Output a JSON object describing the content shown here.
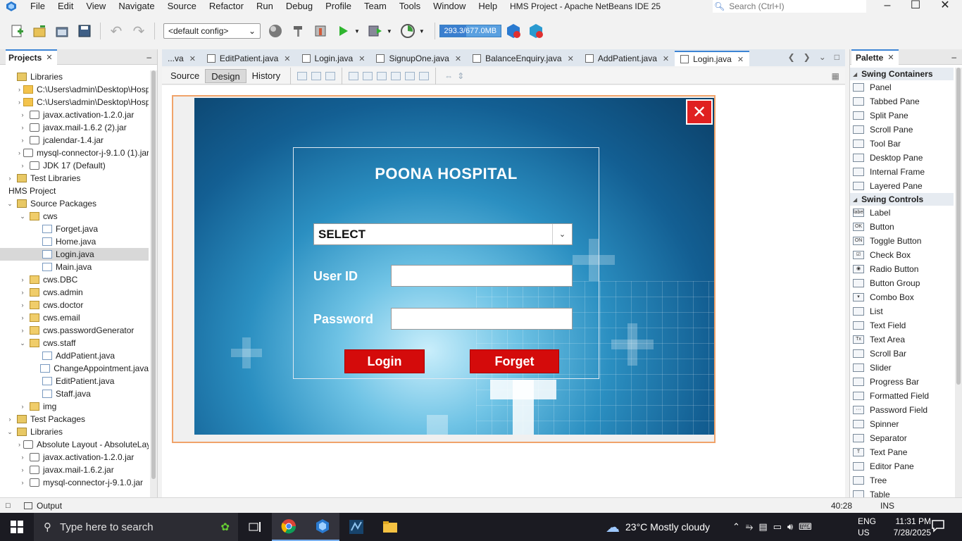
{
  "window": {
    "title": "HMS Project - Apache NetBeans IDE 25"
  },
  "menu": [
    "File",
    "Edit",
    "View",
    "Navigate",
    "Source",
    "Refactor",
    "Run",
    "Debug",
    "Profile",
    "Team",
    "Tools",
    "Window",
    "Help"
  ],
  "search": {
    "placeholder": "Search (Ctrl+I)"
  },
  "toolbar": {
    "config": "<default config>",
    "memory": "293.3/677.0MB",
    "memory_fraction": 0.43
  },
  "projects": {
    "title": "Projects",
    "tree": [
      {
        "label": "Libraries",
        "level": 0,
        "toggle": "",
        "icon": "lib"
      },
      {
        "label": "C:\\Users\\admin\\Desktop\\Hosp",
        "level": 1,
        "toggle": "›",
        "icon": "folder"
      },
      {
        "label": "C:\\Users\\admin\\Desktop\\Hosp",
        "level": 1,
        "toggle": "›",
        "icon": "folder"
      },
      {
        "label": "javax.activation-1.2.0.jar",
        "level": 1,
        "toggle": "›",
        "icon": "jar"
      },
      {
        "label": "javax.mail-1.6.2 (2).jar",
        "level": 1,
        "toggle": "›",
        "icon": "jar"
      },
      {
        "label": "jcalendar-1.4.jar",
        "level": 1,
        "toggle": "›",
        "icon": "jar"
      },
      {
        "label": "mysql-connector-j-9.1.0 (1).jar",
        "level": 1,
        "toggle": "›",
        "icon": "jar"
      },
      {
        "label": "JDK 17 (Default)",
        "level": 1,
        "toggle": "›",
        "icon": "jar"
      },
      {
        "label": "Test Libraries",
        "level": 0,
        "toggle": "›",
        "icon": "lib"
      },
      {
        "label": "HMS Project",
        "level": -1,
        "toggle": "",
        "icon": "none"
      },
      {
        "label": "Source Packages",
        "level": 0,
        "toggle": "⌄",
        "icon": "lib"
      },
      {
        "label": "cws",
        "level": 1,
        "toggle": "⌄",
        "icon": "pkg"
      },
      {
        "label": "Forget.java",
        "level": 2,
        "toggle": "",
        "icon": "java"
      },
      {
        "label": "Home.java",
        "level": 2,
        "toggle": "",
        "icon": "java"
      },
      {
        "label": "Login.java",
        "level": 2,
        "toggle": "",
        "icon": "java",
        "selected": true
      },
      {
        "label": "Main.java",
        "level": 2,
        "toggle": "",
        "icon": "java"
      },
      {
        "label": "cws.DBC",
        "level": 1,
        "toggle": "›",
        "icon": "pkg"
      },
      {
        "label": "cws.admin",
        "level": 1,
        "toggle": "›",
        "icon": "pkg"
      },
      {
        "label": "cws.doctor",
        "level": 1,
        "toggle": "›",
        "icon": "pkg"
      },
      {
        "label": "cws.email",
        "level": 1,
        "toggle": "›",
        "icon": "pkg"
      },
      {
        "label": "cws.passwordGenerator",
        "level": 1,
        "toggle": "›",
        "icon": "pkg"
      },
      {
        "label": "cws.staff",
        "level": 1,
        "toggle": "⌄",
        "icon": "pkg"
      },
      {
        "label": "AddPatient.java",
        "level": 2,
        "toggle": "",
        "icon": "java"
      },
      {
        "label": "ChangeAppointment.java",
        "level": 2,
        "toggle": "",
        "icon": "java"
      },
      {
        "label": "EditPatient.java",
        "level": 2,
        "toggle": "",
        "icon": "java"
      },
      {
        "label": "Staff.java",
        "level": 2,
        "toggle": "",
        "icon": "java"
      },
      {
        "label": "img",
        "level": 1,
        "toggle": "›",
        "icon": "pkg"
      },
      {
        "label": "Test Packages",
        "level": 0,
        "toggle": "›",
        "icon": "lib"
      },
      {
        "label": "Libraries",
        "level": 0,
        "toggle": "⌄",
        "icon": "lib"
      },
      {
        "label": "Absolute Layout - AbsoluteLay",
        "level": 1,
        "toggle": "›",
        "icon": "jar"
      },
      {
        "label": "javax.activation-1.2.0.jar",
        "level": 1,
        "toggle": "›",
        "icon": "jar"
      },
      {
        "label": "javax.mail-1.6.2.jar",
        "level": 1,
        "toggle": "›",
        "icon": "jar"
      },
      {
        "label": "mysql-connector-j-9.1.0.jar",
        "level": 1,
        "toggle": "›",
        "icon": "jar"
      }
    ]
  },
  "editor": {
    "tabs": [
      {
        "label": "...va",
        "active": false,
        "icon": false
      },
      {
        "label": "EditPatient.java",
        "active": false,
        "icon": true
      },
      {
        "label": "Login.java",
        "active": false,
        "icon": true
      },
      {
        "label": "SignupOne.java",
        "active": false,
        "icon": true
      },
      {
        "label": "BalanceEnquiry.java",
        "active": false,
        "icon": true
      },
      {
        "label": "AddPatient.java",
        "active": false,
        "icon": true
      },
      {
        "label": "Login.java",
        "active": true,
        "icon": true
      }
    ],
    "views": [
      "Source",
      "Design",
      "History"
    ],
    "active_view": "Design"
  },
  "login_form": {
    "title": "POONA HOSPITAL",
    "role_select": "SELECT",
    "user_id_label": "User ID",
    "password_label": "Password",
    "login_button": "Login",
    "forget_button": "Forget",
    "close_glyph": "✕"
  },
  "palette": {
    "title": "Palette",
    "categories": [
      {
        "name": "Swing Containers",
        "items": [
          {
            "label": "Panel",
            "glyph": ""
          },
          {
            "label": "Tabbed Pane",
            "glyph": ""
          },
          {
            "label": "Split Pane",
            "glyph": ""
          },
          {
            "label": "Scroll Pane",
            "glyph": ""
          },
          {
            "label": "Tool Bar",
            "glyph": ""
          },
          {
            "label": "Desktop Pane",
            "glyph": ""
          },
          {
            "label": "Internal Frame",
            "glyph": ""
          },
          {
            "label": "Layered Pane",
            "glyph": ""
          }
        ]
      },
      {
        "name": "Swing Controls",
        "items": [
          {
            "label": "Label",
            "glyph": "label"
          },
          {
            "label": "Button",
            "glyph": "OK"
          },
          {
            "label": "Toggle Button",
            "glyph": "ON"
          },
          {
            "label": "Check Box",
            "glyph": "☑"
          },
          {
            "label": "Radio Button",
            "glyph": "◉"
          },
          {
            "label": "Button Group",
            "glyph": ""
          },
          {
            "label": "Combo Box",
            "glyph": "▾"
          },
          {
            "label": "List",
            "glyph": ""
          },
          {
            "label": "Text Field",
            "glyph": ""
          },
          {
            "label": "Text Area",
            "glyph": "Tx"
          },
          {
            "label": "Scroll Bar",
            "glyph": ""
          },
          {
            "label": "Slider",
            "glyph": ""
          },
          {
            "label": "Progress Bar",
            "glyph": ""
          },
          {
            "label": "Formatted Field",
            "glyph": ""
          },
          {
            "label": "Password Field",
            "glyph": "···"
          },
          {
            "label": "Spinner",
            "glyph": ""
          },
          {
            "label": "Separator",
            "glyph": ""
          },
          {
            "label": "Text Pane",
            "glyph": "T"
          },
          {
            "label": "Editor Pane",
            "glyph": ""
          },
          {
            "label": "Tree",
            "glyph": ""
          },
          {
            "label": "Table",
            "glyph": ""
          }
        ]
      }
    ]
  },
  "status": {
    "output": "Output",
    "cursor": "40:28",
    "mode": "INS"
  },
  "taskbar": {
    "search_placeholder": "Type here to search",
    "weather": "23°C  Mostly cloudy",
    "lang": "ENG",
    "region": "US",
    "time": "11:31 PM",
    "date": "7/28/2025"
  },
  "colors": {
    "accent": "#3c84d4",
    "danger": "#d40b0b",
    "form_border": "#f0a36a"
  }
}
